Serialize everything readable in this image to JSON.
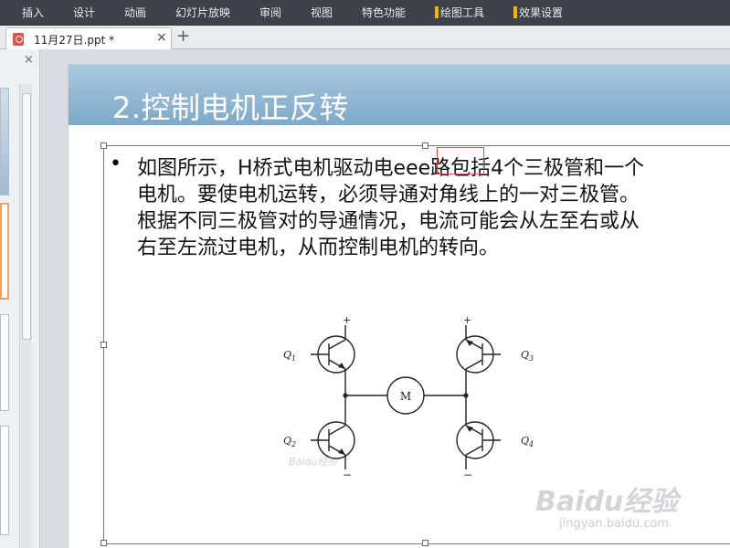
{
  "ribbon": {
    "tabs": [
      {
        "label": "插入"
      },
      {
        "label": "设计"
      },
      {
        "label": "动画"
      },
      {
        "label": "幻灯片放映"
      },
      {
        "label": "审阅"
      },
      {
        "label": "视图"
      },
      {
        "label": "特色功能"
      },
      {
        "label": "绘图工具",
        "contextual": true
      },
      {
        "label": "效果设置",
        "contextual": true
      }
    ],
    "accent": "#f2b400"
  },
  "document": {
    "tab_title": "11月27日.ppt *",
    "close_glyph": "×",
    "new_tab_glyph": "+",
    "icon": "ppt-file-icon"
  },
  "left_pane": {
    "close_glyph": "×"
  },
  "slide": {
    "title": "2.控制电机正反转",
    "bullet": "•",
    "lines": [
      "如图所示，H桥式电机驱动电eee路包括4个三极管和一个",
      "电机。要使电机运转，必须导通对角线上的一对三极管。",
      "根据不同三极管对的导通情况，电流可能会从左至右或从",
      "右至左流过电机，从而控制电机的转向。"
    ],
    "circuit": {
      "motor_label": "M",
      "plus": "+",
      "minus": "−",
      "transistors": [
        {
          "label": "Q",
          "sub": "1"
        },
        {
          "label": "Q",
          "sub": "2"
        },
        {
          "label": "Q",
          "sub": "3"
        },
        {
          "label": "Q",
          "sub": "4"
        }
      ]
    }
  },
  "watermark": {
    "logo": "Baidu经验",
    "url": "jingyan.baidu.com",
    "small": "Baidu经验"
  },
  "colors": {
    "ribbon_bg": "#3d4148",
    "title_band": "#7ea9ca",
    "selection_red": "#d9534f"
  }
}
